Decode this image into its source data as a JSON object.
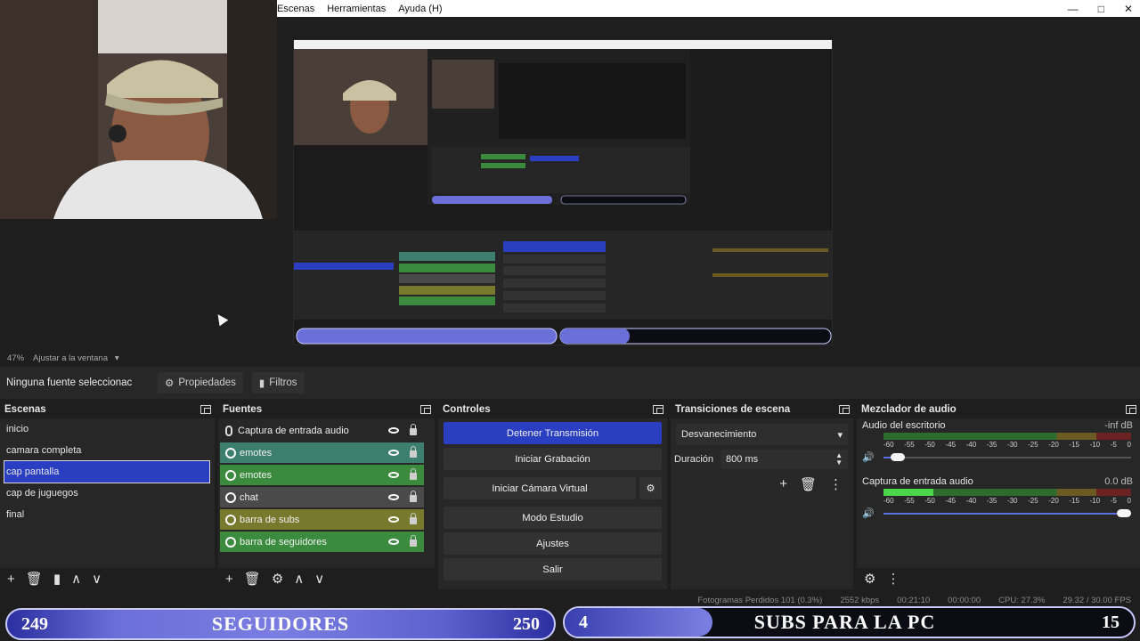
{
  "menu": [
    "Escenas",
    "Herramientas",
    "Ayuda (H)"
  ],
  "window_controls": [
    "—",
    "□",
    "✕"
  ],
  "zoom": {
    "percent": "47%",
    "fit_label": "Ajustar a la ventana"
  },
  "properties_bar": {
    "no_source": "Ninguna fuente seleccionac",
    "properties": "Propiedades",
    "filters": "Filtros"
  },
  "scenes": {
    "title": "Escenas",
    "items": [
      "inicio",
      "camara completa",
      "cap pantalla",
      "cap de juguegos",
      "final"
    ],
    "selected_index": 2
  },
  "sources": {
    "title": "Fuentes",
    "items": [
      {
        "name": "Captura de entrada audio",
        "color": "#272727",
        "kind": "mic"
      },
      {
        "name": "emotes",
        "color": "#3d7f6e",
        "kind": "browser"
      },
      {
        "name": "emotes",
        "color": "#3b8b3e",
        "kind": "browser"
      },
      {
        "name": "chat",
        "color": "#4a4a4a",
        "kind": "browser"
      },
      {
        "name": "barra de subs",
        "color": "#777a2c",
        "kind": "browser"
      },
      {
        "name": "barra de seguidores",
        "color": "#3b8b3e",
        "kind": "browser"
      }
    ]
  },
  "controls": {
    "title": "Controles",
    "buttons": [
      "Detener Transmisión",
      "Iniciar Grabación",
      "Iniciar Cámara Virtual",
      "Modo Estudio",
      "Ajustes",
      "Salir"
    ]
  },
  "transitions": {
    "title": "Transiciones de escena",
    "selected": "Desvanecimiento",
    "duration_label": "Duración",
    "duration_value": "800 ms"
  },
  "mixer": {
    "title": "Mezclador de audio",
    "channels": [
      {
        "name": "Audio del escritorio",
        "level": "-inf dB",
        "meter_fill": 0.0,
        "volume": 0.03
      },
      {
        "name": "Captura de entrada audio",
        "level": "0.0 dB",
        "meter_fill": 0.2,
        "volume": 1.0
      }
    ],
    "ticks": [
      "-60",
      "-55",
      "-50",
      "-45",
      "-40",
      "-35",
      "-30",
      "-25",
      "-20",
      "-15",
      "-10",
      "-5",
      "0"
    ]
  },
  "status": {
    "dropped": "Fotogramas Perdidos 101 (0.3%)",
    "bitrate": "2552 kbps",
    "live": "00:21:10",
    "rec": "00:00:00",
    "cpu": "CPU: 27.3%",
    "fps": "29.32 / 30.00 FPS"
  },
  "overlay": {
    "followers_current": "249",
    "followers_label": "SEGUIDORES",
    "followers_goal": "250",
    "subs_current": "4",
    "subs_label": "SUBS PARA LA PC",
    "subs_goal": "15"
  },
  "colors": {
    "accent": "#2a3ec2",
    "panel": "#272727",
    "background": "#1e1e1e"
  }
}
